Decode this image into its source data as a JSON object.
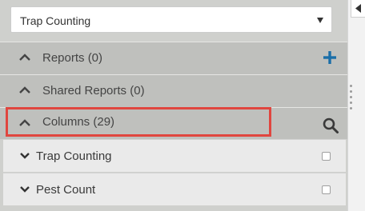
{
  "dropdown": {
    "selected": "Trap Counting"
  },
  "sections": {
    "reports": {
      "label": "Reports (0)",
      "action_icon": "plus-icon"
    },
    "shared_reports": {
      "label": "Shared Reports (0)"
    },
    "columns": {
      "label": "Columns (29)",
      "action_icon": "search-icon"
    }
  },
  "columns_list": [
    {
      "label": "Trap Counting",
      "checked": false
    },
    {
      "label": "Pest Count",
      "checked": false
    }
  ],
  "colors": {
    "accent_plus": "#1a6ea8",
    "highlight": "#e0463f"
  }
}
